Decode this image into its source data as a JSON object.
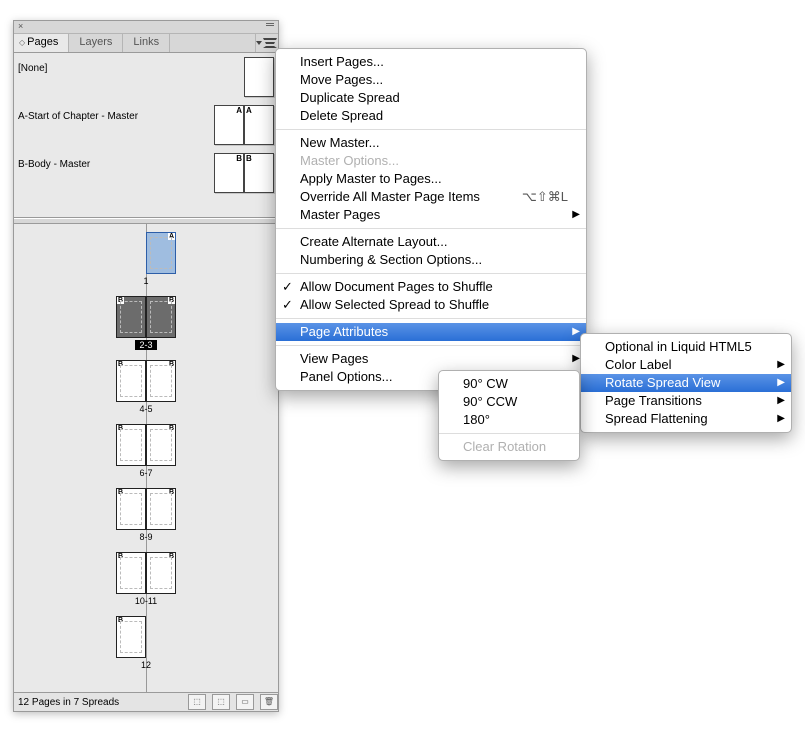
{
  "tabs": {
    "pages": "Pages",
    "layers": "Layers",
    "links": "Links"
  },
  "masters": [
    {
      "label": "[None]",
      "pages": 1,
      "letter": ""
    },
    {
      "label": "A-Start of Chapter - Master",
      "pages": 2,
      "letter": "A"
    },
    {
      "label": "B-Body - Master",
      "pages": 2,
      "letter": "B"
    }
  ],
  "spreads": [
    {
      "label": "1",
      "pages": [
        "A"
      ],
      "right_only": true,
      "selected_page": true
    },
    {
      "label": "2-3",
      "pages": [
        "B",
        "B"
      ],
      "dark": true,
      "selected_label": true
    },
    {
      "label": "4-5",
      "pages": [
        "B",
        "B"
      ]
    },
    {
      "label": "6-7",
      "pages": [
        "B",
        "B"
      ]
    },
    {
      "label": "8-9",
      "pages": [
        "B",
        "B"
      ]
    },
    {
      "label": "10-11",
      "pages": [
        "B",
        "B"
      ]
    },
    {
      "label": "12",
      "pages": [
        "B"
      ],
      "left_only": true
    }
  ],
  "status": "12 Pages in 7 Spreads",
  "menu_main": [
    {
      "t": "Insert Pages..."
    },
    {
      "t": "Move Pages..."
    },
    {
      "t": "Duplicate Spread"
    },
    {
      "t": "Delete Spread"
    },
    {
      "sep": true
    },
    {
      "t": "New Master..."
    },
    {
      "t": "Master Options...",
      "disabled": true
    },
    {
      "t": "Apply Master to Pages..."
    },
    {
      "t": "Override All Master Page Items",
      "shortcut": "⌥⇧⌘L"
    },
    {
      "t": "Master Pages",
      "sub": true
    },
    {
      "sep": true
    },
    {
      "t": "Create Alternate Layout..."
    },
    {
      "t": "Numbering & Section Options..."
    },
    {
      "sep": true
    },
    {
      "t": "Allow Document Pages to Shuffle",
      "check": true
    },
    {
      "t": "Allow Selected Spread to Shuffle",
      "check": true
    },
    {
      "sep": true
    },
    {
      "t": "Page Attributes",
      "sub": true,
      "hl": true
    },
    {
      "sep": true
    },
    {
      "t": "View Pages",
      "sub": true
    },
    {
      "t": "Panel Options..."
    }
  ],
  "menu_attrs": [
    {
      "t": "Optional in Liquid HTML5"
    },
    {
      "t": "Color Label",
      "sub": true
    },
    {
      "t": "Rotate Spread View",
      "sub": true,
      "hl": true
    },
    {
      "t": "Page Transitions",
      "sub": true
    },
    {
      "t": "Spread Flattening",
      "sub": true
    }
  ],
  "menu_rotate": [
    {
      "t": "90° CW"
    },
    {
      "t": "90° CCW"
    },
    {
      "t": "180°"
    },
    {
      "sep": true
    },
    {
      "t": "Clear Rotation",
      "disabled": true
    }
  ]
}
